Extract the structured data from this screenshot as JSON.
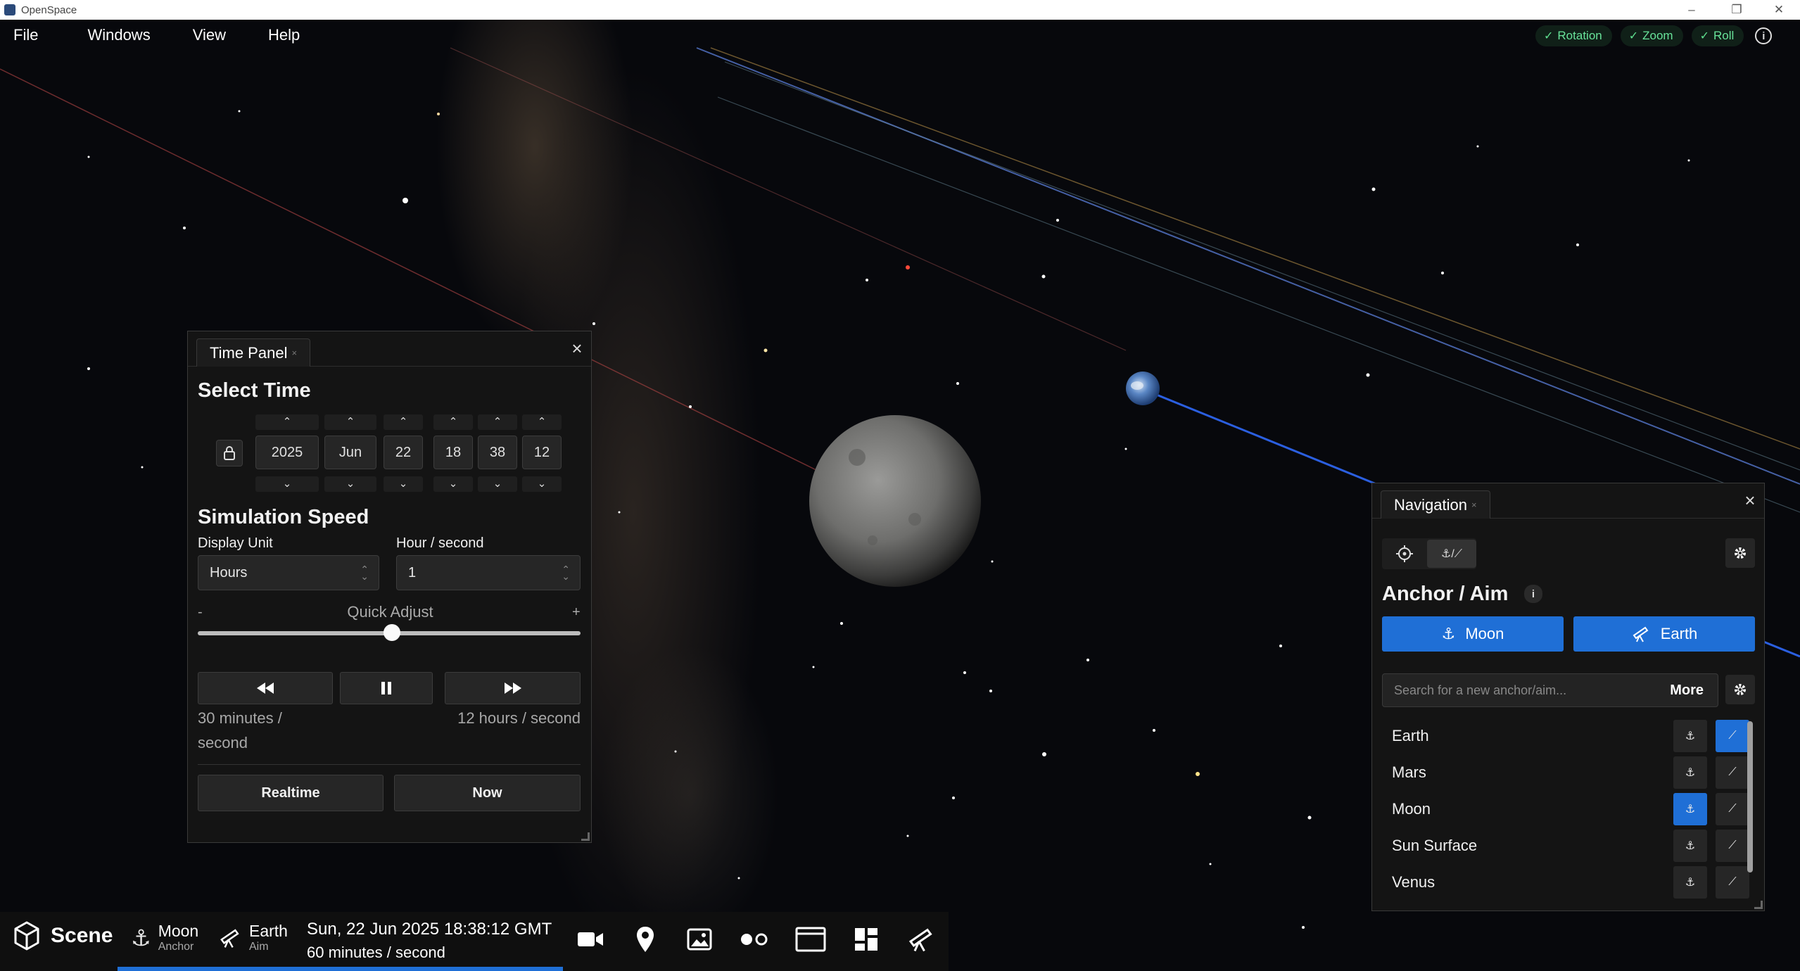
{
  "window": {
    "title": "OpenSpace"
  },
  "menu": {
    "items": [
      "File",
      "Windows",
      "View",
      "Help"
    ]
  },
  "camera_toggles": [
    {
      "label": "Rotation",
      "checked": true
    },
    {
      "label": "Zoom",
      "checked": true
    },
    {
      "label": "Roll",
      "checked": true
    }
  ],
  "time_panel": {
    "tab_label": "Time Panel",
    "select_time_heading": "Select Time",
    "date_fields": {
      "year": "2025",
      "month": "Jun",
      "day": "22",
      "hour": "18",
      "minute": "38",
      "second": "12"
    },
    "simulation_speed_heading": "Simulation Speed",
    "display_unit_label": "Display Unit",
    "display_unit_value": "Hours",
    "rate_label": "Hour / second",
    "rate_value": "1",
    "quick_adjust": {
      "label": "Quick Adjust",
      "minus": "-",
      "plus": "+",
      "position": 0.5
    },
    "step_back_label": "30 minutes / second",
    "step_forward_label": "12 hours / second",
    "realtime_button": "Realtime",
    "now_button": "Now"
  },
  "navigation_panel": {
    "tab_label": "Navigation",
    "heading": "Anchor / Aim",
    "anchor_button": "Moon",
    "aim_button": "Earth",
    "search_placeholder": "Search for a new anchor/aim...",
    "more_label": "More",
    "rows": [
      {
        "name": "Earth",
        "anchor_active": false,
        "aim_active": true
      },
      {
        "name": "Mars",
        "anchor_active": false,
        "aim_active": false
      },
      {
        "name": "Moon",
        "anchor_active": true,
        "aim_active": false
      },
      {
        "name": "Sun Surface",
        "anchor_active": false,
        "aim_active": false
      },
      {
        "name": "Venus",
        "anchor_active": false,
        "aim_active": false
      }
    ]
  },
  "bottom_bar": {
    "scene_label": "Scene",
    "anchor_name": "Moon",
    "anchor_caption": "Anchor",
    "aim_name": "Earth",
    "aim_caption": "Aim",
    "date_time": "Sun, 22 Jun 2025 18:38:12 GMT",
    "speed": "60 minutes / second",
    "tool_icons": [
      "video-camera-icon",
      "map-pin-icon",
      "image-icon",
      "flickr-dots-icon",
      "window-icon",
      "dashboard-icon",
      "telescope-icon"
    ]
  },
  "colors": {
    "accent": "#1f6fd6",
    "toggle_green": "#5fe08f",
    "panel_bg": "#141414"
  }
}
